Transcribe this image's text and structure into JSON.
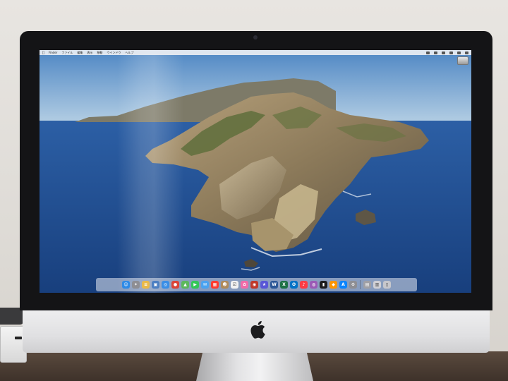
{
  "photo": {
    "subject": "iMac",
    "colors": {
      "wall": "#e4e1dc",
      "bezel": "#141416",
      "aluminum": "#e2e2e4",
      "desk": "#4a3d33",
      "sea": "#1f4d8f",
      "sky": "#86b1da",
      "island": "#9a8868"
    }
  },
  "menubar": {
    "apple_icon": "apple-icon",
    "items": [
      "Finder",
      "ファイル",
      "編集",
      "表示",
      "移動",
      "ウインドウ",
      "ヘルプ"
    ]
  },
  "desktop": {
    "drive_label": "Macintosh HD"
  },
  "dock": {
    "apps": [
      {
        "name": "finder-icon",
        "glyph": "☺",
        "color": "#2e8ae6"
      },
      {
        "name": "launchpad-icon",
        "glyph": "✦",
        "color": "#8e8e93"
      },
      {
        "name": "notes-icon",
        "glyph": "≡",
        "color": "#e9b949"
      },
      {
        "name": "preview-icon",
        "glyph": "▣",
        "color": "#4c7fc2"
      },
      {
        "name": "safari-icon",
        "glyph": "◎",
        "color": "#3a8ee6"
      },
      {
        "name": "chrome-icon",
        "glyph": "●",
        "color": "#db4437"
      },
      {
        "name": "maps-icon",
        "glyph": "▲",
        "color": "#5cb85c"
      },
      {
        "name": "facetime-icon",
        "glyph": "▶",
        "color": "#34c759"
      },
      {
        "name": "mail-icon",
        "glyph": "✉",
        "color": "#4aa3f0"
      },
      {
        "name": "calendar-icon",
        "glyph": "▦",
        "color": "#ff3b30"
      },
      {
        "name": "contacts-icon",
        "glyph": "☻",
        "color": "#b08a5a"
      },
      {
        "name": "reminders-icon",
        "glyph": "☑",
        "color": "#f2f2f2"
      },
      {
        "name": "photos-icon",
        "glyph": "✿",
        "color": "#f06ba8"
      },
      {
        "name": "photobooth-icon",
        "glyph": "◉",
        "color": "#c0392b"
      },
      {
        "name": "star-app-icon",
        "glyph": "★",
        "color": "#5856d6"
      },
      {
        "name": "word-icon",
        "glyph": "W",
        "color": "#2b5797"
      },
      {
        "name": "excel-icon",
        "glyph": "X",
        "color": "#1e7145"
      },
      {
        "name": "outlook-icon",
        "glyph": "O",
        "color": "#0072c6"
      },
      {
        "name": "music-icon",
        "glyph": "♪",
        "color": "#fc3c44"
      },
      {
        "name": "podcasts-icon",
        "glyph": "◍",
        "color": "#9b59b6"
      },
      {
        "name": "appletv-icon",
        "glyph": "▮",
        "color": "#1c1c1e"
      },
      {
        "name": "books-icon",
        "glyph": "◆",
        "color": "#ff9500"
      },
      {
        "name": "appstore-icon",
        "glyph": "A",
        "color": "#0a84ff"
      },
      {
        "name": "system-preferences-icon",
        "glyph": "⚙",
        "color": "#8e8e93"
      },
      {
        "name": "image-capture-icon",
        "glyph": "▤",
        "color": "#a0a0a5"
      },
      {
        "name": "downloads-icon",
        "glyph": "▥",
        "color": "#d0d0d5"
      },
      {
        "name": "trash-icon",
        "glyph": "▯",
        "color": "#c7c7cc"
      }
    ]
  }
}
